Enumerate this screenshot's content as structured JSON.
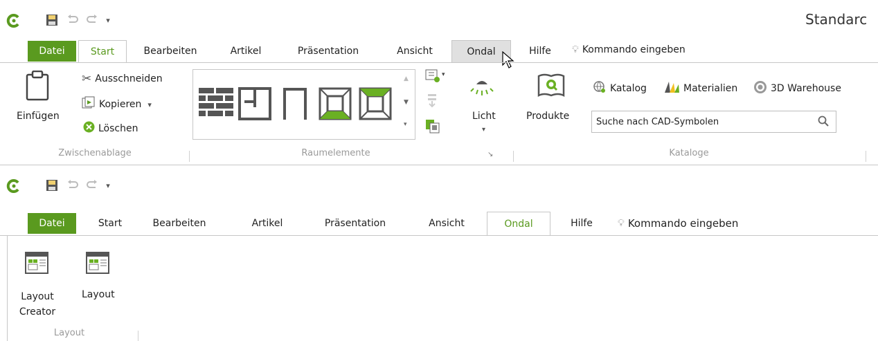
{
  "top": {
    "window_title": "Standarc",
    "tabs": [
      {
        "label": "Datei"
      },
      {
        "label": "Start"
      },
      {
        "label": "Bearbeiten"
      },
      {
        "label": "Artikel"
      },
      {
        "label": "Präsentation"
      },
      {
        "label": "Ansicht"
      },
      {
        "label": "Ondal"
      },
      {
        "label": "Hilfe"
      }
    ],
    "command_hint": "Kommando eingeben",
    "clipboard": {
      "paste_label": "Einfügen",
      "cut_label": "Ausschneiden",
      "copy_label": "Kopieren",
      "delete_label": "Löschen",
      "group_label": "Zwischenablage"
    },
    "room_elements": {
      "group_label": "Raumelemente"
    },
    "light_label": "Licht",
    "products_label": "Produkte",
    "catalogs": {
      "catalog_label": "Katalog",
      "materials_label": "Materialien",
      "warehouse_label": "3D Warehouse",
      "search_placeholder": "Suche nach CAD-Symbolen",
      "group_label": "Kataloge"
    }
  },
  "bottom": {
    "tabs": [
      {
        "label": "Datei"
      },
      {
        "label": "Start"
      },
      {
        "label": "Bearbeiten"
      },
      {
        "label": "Artikel"
      },
      {
        "label": "Präsentation"
      },
      {
        "label": "Ansicht"
      },
      {
        "label": "Ondal"
      },
      {
        "label": "Hilfe"
      }
    ],
    "command_hint": "Kommando eingeben",
    "layout_creator_line1": "Layout",
    "layout_creator_line2": "Creator",
    "layout_label": "Layout",
    "group_label": "Layout"
  },
  "colors": {
    "accent": "#5a9a1f",
    "active_tab_text": "#5a9a1f",
    "hover_tab": "#e0e0e0"
  }
}
